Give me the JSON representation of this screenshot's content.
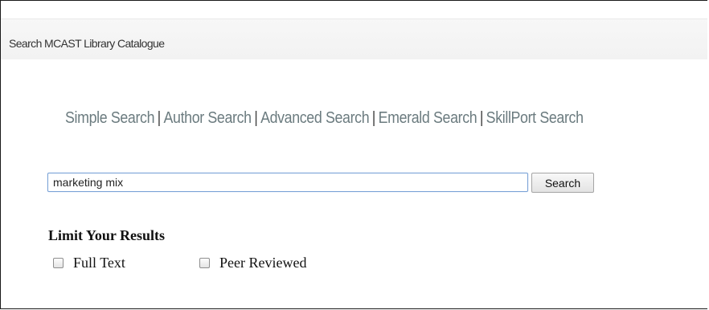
{
  "panel": {
    "title": "Search MCAST Library Catalogue"
  },
  "search_tabs": [
    {
      "label": "Simple Search"
    },
    {
      "label": "Author Search"
    },
    {
      "label": "Advanced Search"
    },
    {
      "label": "Emerald Search"
    },
    {
      "label": "SkillPort Search"
    }
  ],
  "separator": "|",
  "search": {
    "query": "marketing mix",
    "button_label": "Search"
  },
  "limits": {
    "title": "Limit Your Results",
    "options": [
      {
        "label": "Full Text",
        "checked": false
      },
      {
        "label": "Peer Reviewed",
        "checked": false
      }
    ]
  },
  "colors": {
    "tab_link": "#6b7b7f",
    "input_border": "#7aa2d6",
    "header_background": "#f2f2f2"
  }
}
